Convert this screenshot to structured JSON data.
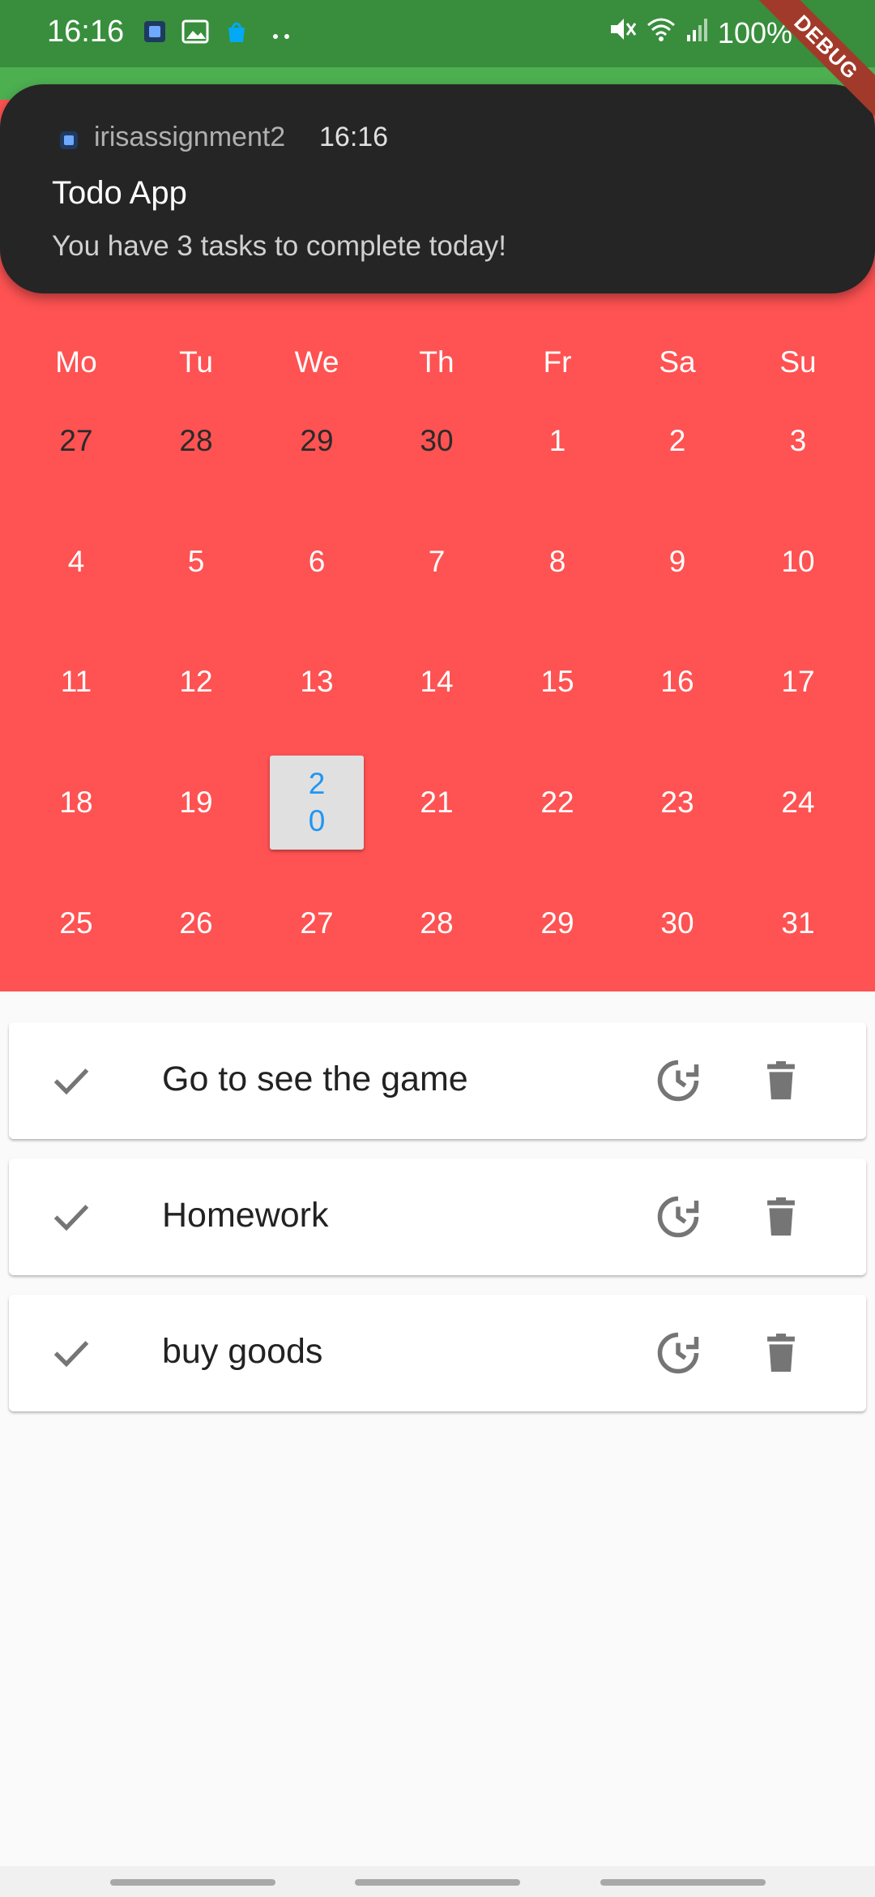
{
  "status_bar": {
    "time": "16:16",
    "battery": "100%"
  },
  "debug_banner": "DEBUG",
  "notification": {
    "app_name": "irisassignment2",
    "time": "16:16",
    "title": "Todo App",
    "body": "You have 3 tasks to complete today!"
  },
  "calendar": {
    "background_color": "#ff5252",
    "weekdays": [
      "Mo",
      "Tu",
      "We",
      "Th",
      "Fr",
      "Sa",
      "Su"
    ],
    "weeks": [
      [
        "27",
        "28",
        "29",
        "30",
        "1",
        "2",
        "3"
      ],
      [
        "4",
        "5",
        "6",
        "7",
        "8",
        "9",
        "10"
      ],
      [
        "11",
        "12",
        "13",
        "14",
        "15",
        "16",
        "17"
      ],
      [
        "18",
        "19",
        "20",
        "21",
        "22",
        "23",
        "24"
      ],
      [
        "25",
        "26",
        "27",
        "28",
        "29",
        "30",
        "31"
      ]
    ],
    "selected_day": "20",
    "selected_color": "#2196f3"
  },
  "tasks": [
    {
      "title": "Go to see the game"
    },
    {
      "title": "Homework"
    },
    {
      "title": "buy goods"
    }
  ],
  "icons": {
    "complete": "check-icon",
    "snooze": "snooze-clock-icon",
    "delete": "trash-icon"
  }
}
